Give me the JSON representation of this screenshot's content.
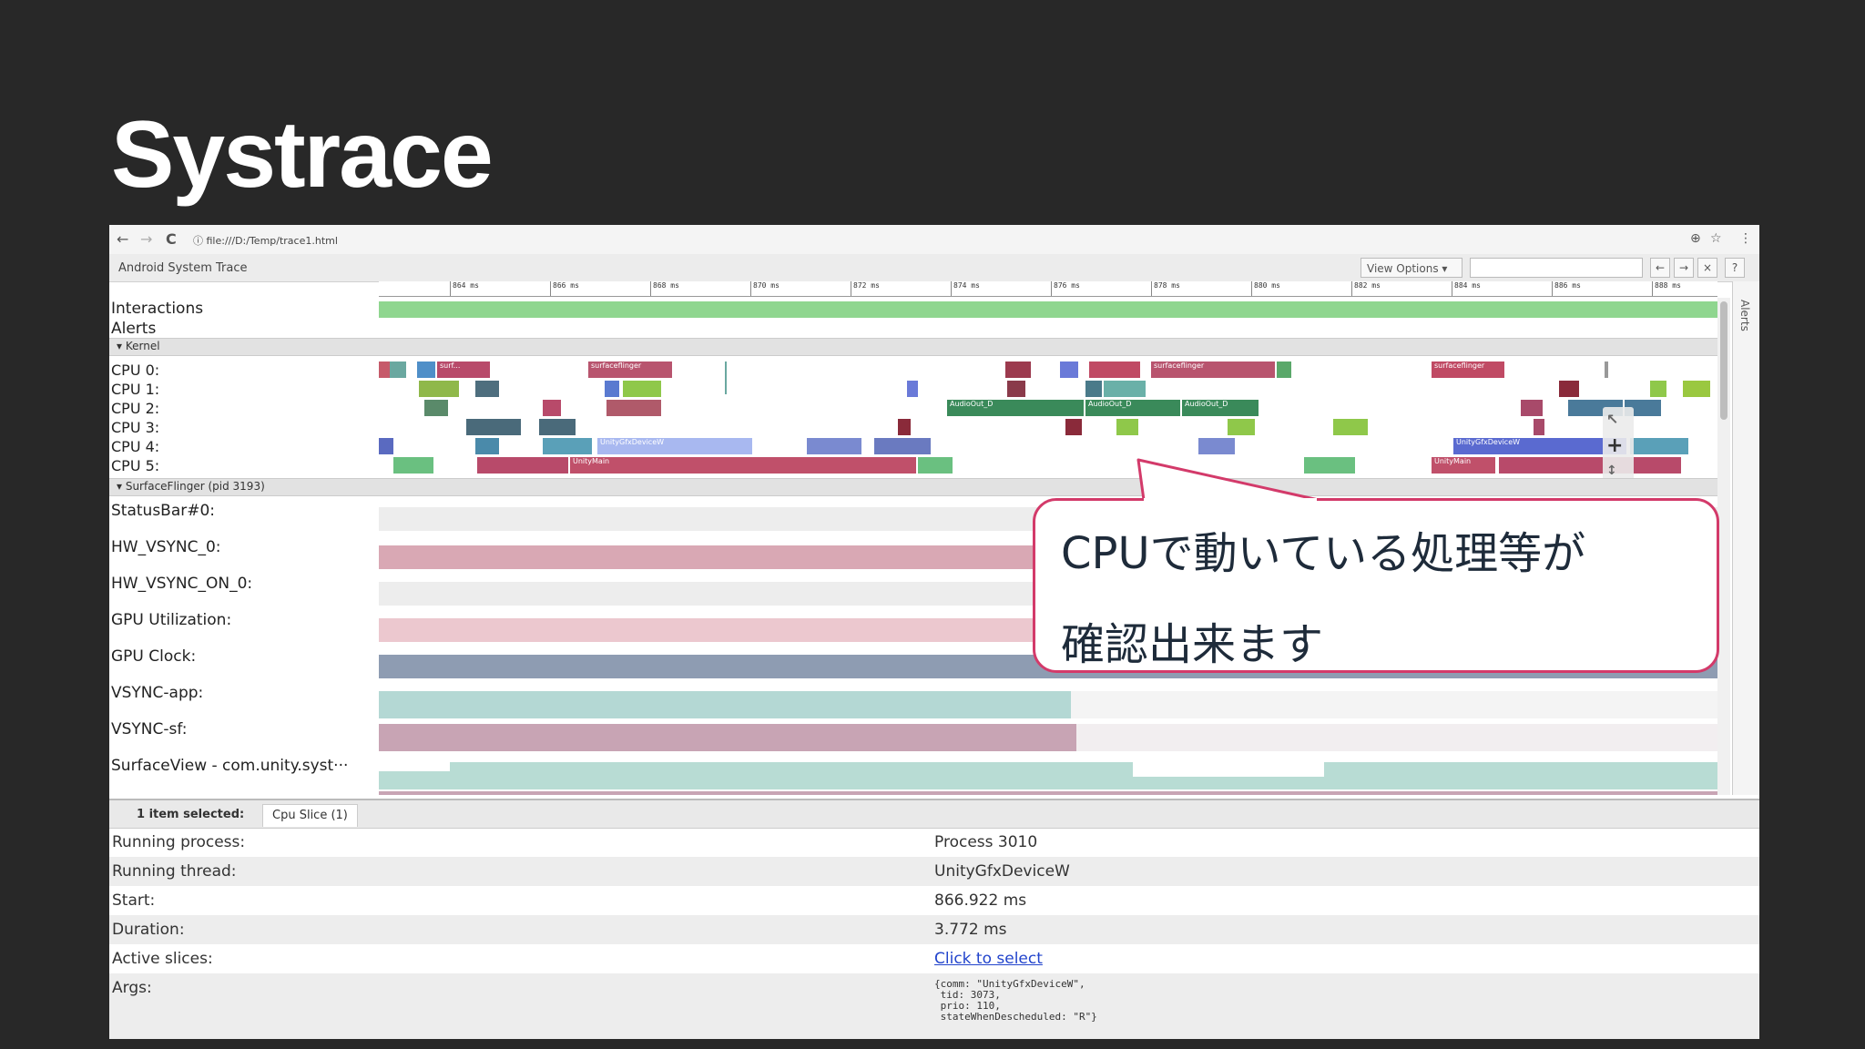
{
  "slide": {
    "title": "Systrace"
  },
  "browser": {
    "back": "←",
    "forward": "→",
    "reload": "C",
    "url": "ⓘ file:///D:/Temp/trace1.html",
    "zoom_icon": "⊕",
    "star_icon": "☆",
    "menu_icon": "⋮"
  },
  "app": {
    "title": "Android System Trace",
    "view_options": "View Options ▾",
    "btn_left": "←",
    "btn_right": "→",
    "btn_x": "×",
    "btn_help": "?"
  },
  "ruler_ticks": [
    "864 ms",
    "866 ms",
    "868 ms",
    "870 ms",
    "872 ms",
    "874 ms",
    "876 ms",
    "878 ms",
    "880 ms",
    "882 ms",
    "884 ms",
    "886 ms",
    "888 ms"
  ],
  "tracks": {
    "interactions": "Interactions",
    "alerts": "Alerts",
    "kernel_section": "▾ Kernel",
    "cpus": [
      "CPU 0:",
      "CPU 1:",
      "CPU 2:",
      "CPU 3:",
      "CPU 4:",
      "CPU 5:"
    ],
    "sf_section": "▾ SurfaceFlinger (pid 3193)",
    "statusbar": "StatusBar#0:",
    "hw_vsync": "HW_VSYNC_0:",
    "hw_vsync_on": "HW_VSYNC_ON_0:",
    "gpu_util": "GPU Utilization:",
    "gpu_clock": "GPU Clock:",
    "vsync_app": "VSYNC-app:",
    "vsync_sf": "VSYNC-sf:",
    "surfaceview": "SurfaceView - com.unity.syst···",
    "alerts_side": "Alerts"
  },
  "cpu_slices": {
    "surfaceflinger_a": "surfaceflinger",
    "surfaceflinger_b": "surfaceflinger",
    "surfaceflinger_c": "surfaceflinger",
    "surf": "surf...",
    "audioout_a": "AudioOut_D",
    "audioout_b": "AudioOut_D",
    "audioout_c": "AudioOut_D",
    "unitygfx_a": "UnityGfxDeviceW",
    "unitygfx_b": "UnityGfxDeviceW",
    "unitymain_a": "UnityMain",
    "unitymain_b": "UnityMain"
  },
  "details": {
    "tab_selected": "1 item selected:",
    "tab_cpu": "Cpu Slice (1)",
    "rows": [
      {
        "key": "Running process:",
        "value": "Process 3010"
      },
      {
        "key": "Running thread:",
        "value": "UnityGfxDeviceW"
      },
      {
        "key": "Start:",
        "value": "866.922 ms"
      },
      {
        "key": "Duration:",
        "value": "3.772 ms"
      },
      {
        "key": "Active slices:",
        "value": "Click to select"
      },
      {
        "key": "Args:",
        "value": ""
      }
    ],
    "args_lines": [
      "{comm: \"UnityGfxDeviceW\",",
      " tid: 3073,",
      " prio: 110,",
      " stateWhenDescheduled: \"R\"}"
    ]
  },
  "callout": {
    "line1": "CPUで動いている処理等が",
    "line2": "確認出来ます"
  }
}
